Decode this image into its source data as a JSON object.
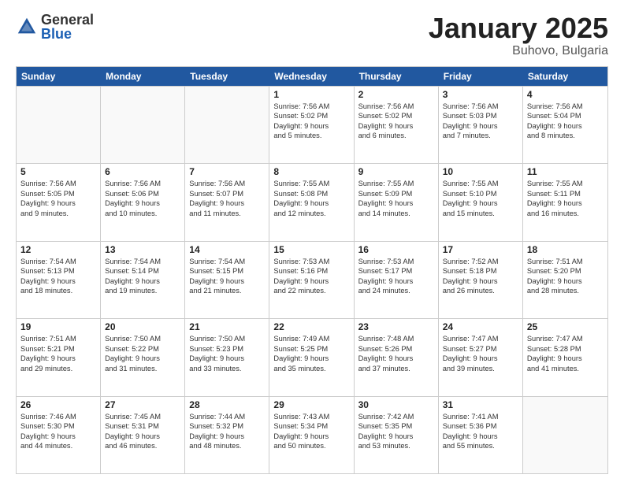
{
  "logo": {
    "general": "General",
    "blue": "Blue"
  },
  "title": "January 2025",
  "location": "Buhovo, Bulgaria",
  "weekdays": [
    "Sunday",
    "Monday",
    "Tuesday",
    "Wednesday",
    "Thursday",
    "Friday",
    "Saturday"
  ],
  "weeks": [
    [
      {
        "day": "",
        "lines": [],
        "empty": true
      },
      {
        "day": "",
        "lines": [],
        "empty": true
      },
      {
        "day": "",
        "lines": [],
        "empty": true
      },
      {
        "day": "1",
        "lines": [
          "Sunrise: 7:56 AM",
          "Sunset: 5:02 PM",
          "Daylight: 9 hours",
          "and 5 minutes."
        ]
      },
      {
        "day": "2",
        "lines": [
          "Sunrise: 7:56 AM",
          "Sunset: 5:02 PM",
          "Daylight: 9 hours",
          "and 6 minutes."
        ]
      },
      {
        "day": "3",
        "lines": [
          "Sunrise: 7:56 AM",
          "Sunset: 5:03 PM",
          "Daylight: 9 hours",
          "and 7 minutes."
        ]
      },
      {
        "day": "4",
        "lines": [
          "Sunrise: 7:56 AM",
          "Sunset: 5:04 PM",
          "Daylight: 9 hours",
          "and 8 minutes."
        ]
      }
    ],
    [
      {
        "day": "5",
        "lines": [
          "Sunrise: 7:56 AM",
          "Sunset: 5:05 PM",
          "Daylight: 9 hours",
          "and 9 minutes."
        ]
      },
      {
        "day": "6",
        "lines": [
          "Sunrise: 7:56 AM",
          "Sunset: 5:06 PM",
          "Daylight: 9 hours",
          "and 10 minutes."
        ]
      },
      {
        "day": "7",
        "lines": [
          "Sunrise: 7:56 AM",
          "Sunset: 5:07 PM",
          "Daylight: 9 hours",
          "and 11 minutes."
        ]
      },
      {
        "day": "8",
        "lines": [
          "Sunrise: 7:55 AM",
          "Sunset: 5:08 PM",
          "Daylight: 9 hours",
          "and 12 minutes."
        ]
      },
      {
        "day": "9",
        "lines": [
          "Sunrise: 7:55 AM",
          "Sunset: 5:09 PM",
          "Daylight: 9 hours",
          "and 14 minutes."
        ]
      },
      {
        "day": "10",
        "lines": [
          "Sunrise: 7:55 AM",
          "Sunset: 5:10 PM",
          "Daylight: 9 hours",
          "and 15 minutes."
        ]
      },
      {
        "day": "11",
        "lines": [
          "Sunrise: 7:55 AM",
          "Sunset: 5:11 PM",
          "Daylight: 9 hours",
          "and 16 minutes."
        ]
      }
    ],
    [
      {
        "day": "12",
        "lines": [
          "Sunrise: 7:54 AM",
          "Sunset: 5:13 PM",
          "Daylight: 9 hours",
          "and 18 minutes."
        ]
      },
      {
        "day": "13",
        "lines": [
          "Sunrise: 7:54 AM",
          "Sunset: 5:14 PM",
          "Daylight: 9 hours",
          "and 19 minutes."
        ]
      },
      {
        "day": "14",
        "lines": [
          "Sunrise: 7:54 AM",
          "Sunset: 5:15 PM",
          "Daylight: 9 hours",
          "and 21 minutes."
        ]
      },
      {
        "day": "15",
        "lines": [
          "Sunrise: 7:53 AM",
          "Sunset: 5:16 PM",
          "Daylight: 9 hours",
          "and 22 minutes."
        ]
      },
      {
        "day": "16",
        "lines": [
          "Sunrise: 7:53 AM",
          "Sunset: 5:17 PM",
          "Daylight: 9 hours",
          "and 24 minutes."
        ]
      },
      {
        "day": "17",
        "lines": [
          "Sunrise: 7:52 AM",
          "Sunset: 5:18 PM",
          "Daylight: 9 hours",
          "and 26 minutes."
        ]
      },
      {
        "day": "18",
        "lines": [
          "Sunrise: 7:51 AM",
          "Sunset: 5:20 PM",
          "Daylight: 9 hours",
          "and 28 minutes."
        ]
      }
    ],
    [
      {
        "day": "19",
        "lines": [
          "Sunrise: 7:51 AM",
          "Sunset: 5:21 PM",
          "Daylight: 9 hours",
          "and 29 minutes."
        ]
      },
      {
        "day": "20",
        "lines": [
          "Sunrise: 7:50 AM",
          "Sunset: 5:22 PM",
          "Daylight: 9 hours",
          "and 31 minutes."
        ]
      },
      {
        "day": "21",
        "lines": [
          "Sunrise: 7:50 AM",
          "Sunset: 5:23 PM",
          "Daylight: 9 hours",
          "and 33 minutes."
        ]
      },
      {
        "day": "22",
        "lines": [
          "Sunrise: 7:49 AM",
          "Sunset: 5:25 PM",
          "Daylight: 9 hours",
          "and 35 minutes."
        ]
      },
      {
        "day": "23",
        "lines": [
          "Sunrise: 7:48 AM",
          "Sunset: 5:26 PM",
          "Daylight: 9 hours",
          "and 37 minutes."
        ]
      },
      {
        "day": "24",
        "lines": [
          "Sunrise: 7:47 AM",
          "Sunset: 5:27 PM",
          "Daylight: 9 hours",
          "and 39 minutes."
        ]
      },
      {
        "day": "25",
        "lines": [
          "Sunrise: 7:47 AM",
          "Sunset: 5:28 PM",
          "Daylight: 9 hours",
          "and 41 minutes."
        ]
      }
    ],
    [
      {
        "day": "26",
        "lines": [
          "Sunrise: 7:46 AM",
          "Sunset: 5:30 PM",
          "Daylight: 9 hours",
          "and 44 minutes."
        ]
      },
      {
        "day": "27",
        "lines": [
          "Sunrise: 7:45 AM",
          "Sunset: 5:31 PM",
          "Daylight: 9 hours",
          "and 46 minutes."
        ]
      },
      {
        "day": "28",
        "lines": [
          "Sunrise: 7:44 AM",
          "Sunset: 5:32 PM",
          "Daylight: 9 hours",
          "and 48 minutes."
        ]
      },
      {
        "day": "29",
        "lines": [
          "Sunrise: 7:43 AM",
          "Sunset: 5:34 PM",
          "Daylight: 9 hours",
          "and 50 minutes."
        ]
      },
      {
        "day": "30",
        "lines": [
          "Sunrise: 7:42 AM",
          "Sunset: 5:35 PM",
          "Daylight: 9 hours",
          "and 53 minutes."
        ]
      },
      {
        "day": "31",
        "lines": [
          "Sunrise: 7:41 AM",
          "Sunset: 5:36 PM",
          "Daylight: 9 hours",
          "and 55 minutes."
        ]
      },
      {
        "day": "",
        "lines": [],
        "empty": true
      }
    ]
  ]
}
